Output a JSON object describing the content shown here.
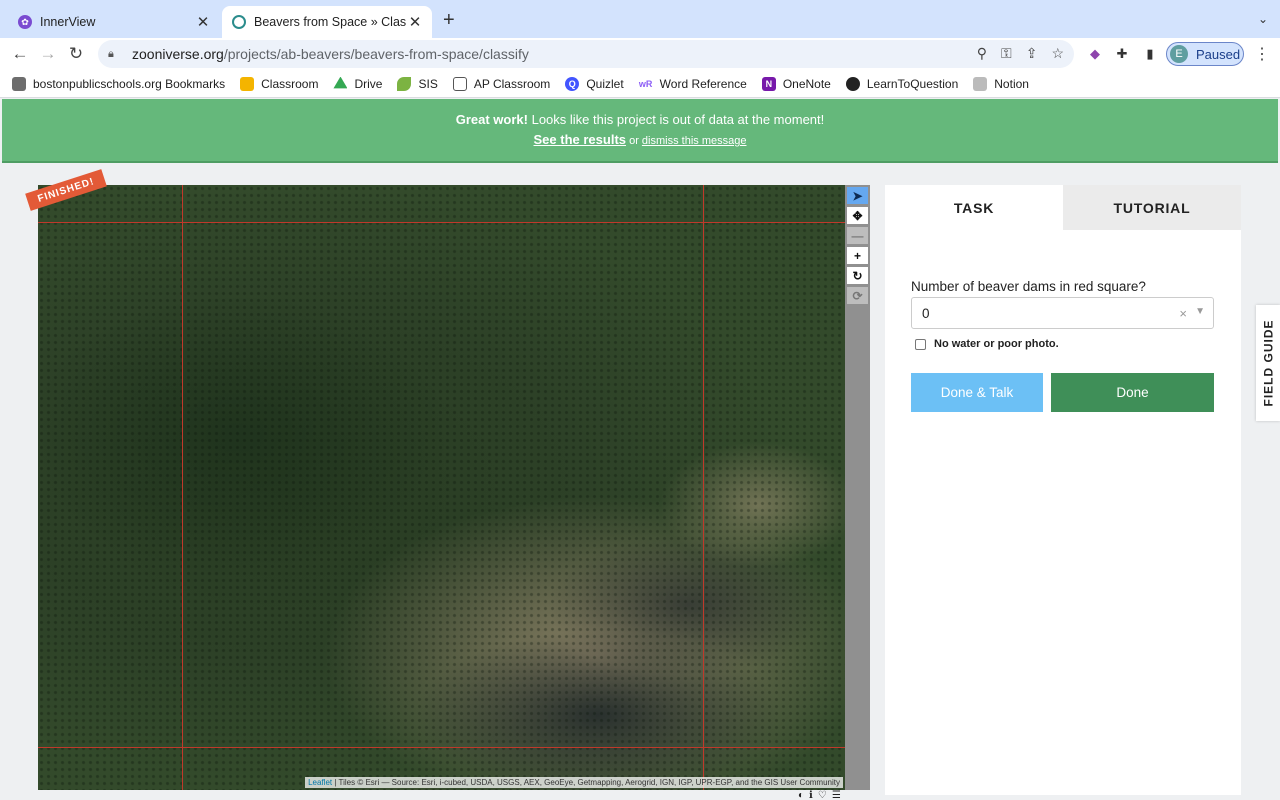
{
  "browser": {
    "tabs": [
      {
        "title": "InnerView",
        "active": false
      },
      {
        "title": "Beavers from Space » Classify",
        "active": true
      }
    ],
    "new_tab": "+",
    "tab_menu": "⌄",
    "url_host": "zooniverse.org",
    "url_path": "/projects/ab-beavers/beavers-from-space/classify",
    "profile_initial": "E",
    "profile_status": "Paused",
    "bookmarks": [
      {
        "label": "bostonpublicschools.org Bookmarks",
        "icon": "folder-icon",
        "color": "#6d6d6d"
      },
      {
        "label": "Classroom",
        "icon": "classroom-icon",
        "color": "#f4b400"
      },
      {
        "label": "Drive",
        "icon": "drive-icon",
        "color": "#34a853"
      },
      {
        "label": "SIS",
        "icon": "sis-icon",
        "color": "#7cb342"
      },
      {
        "label": "AP Classroom",
        "icon": "ap-icon",
        "color": "#555555"
      },
      {
        "label": "Quizlet",
        "icon": "quizlet-icon",
        "color": "#4255ff"
      },
      {
        "label": "Word Reference",
        "icon": "wordreference-icon",
        "color": "#8b5cf6"
      },
      {
        "label": "OneNote",
        "icon": "onenote-icon",
        "color": "#7719aa"
      },
      {
        "label": "LearnToQuestion",
        "icon": "globe-icon",
        "color": "#222222"
      },
      {
        "label": "Notion",
        "icon": "notion-icon",
        "color": "#999999"
      }
    ]
  },
  "banner": {
    "bold": "Great work!",
    "message": " Looks like this project is out of data at the moment!",
    "results_link": "See the results",
    "or": " or ",
    "dismiss_link": "dismiss this message",
    "color": "#65b87b"
  },
  "subject": {
    "finished_badge": "FINISHED!",
    "attribution_leaflet": "Leaflet",
    "attribution_rest": " | Tiles © Esri — Source: Esri, i-cubed, USDA, USGS, AEX, GeoEye, Getmapping, Aerogrid, IGN, IGP, UPR-EGP, and the GIS User Community"
  },
  "tools": [
    {
      "name": "pointer-tool",
      "glyph": "➤",
      "state": "selected"
    },
    {
      "name": "pan-tool",
      "glyph": "✥",
      "state": "normal"
    },
    {
      "name": "zoom-out-tool",
      "glyph": "—",
      "state": "disabled"
    },
    {
      "name": "zoom-in-tool",
      "glyph": "+",
      "state": "normal"
    },
    {
      "name": "rotate-tool",
      "glyph": "↻",
      "state": "normal"
    },
    {
      "name": "reset-tool",
      "glyph": "⟳",
      "state": "disabled"
    }
  ],
  "task_panel": {
    "tab_task": "TASK",
    "tab_tutorial": "TUTORIAL",
    "question": "Number of beaver dams in red square?",
    "select_value": "0",
    "select_clear": "×",
    "checkbox_label": "No water or poor photo.",
    "done_talk": "Done & Talk",
    "done": "Done"
  },
  "field_guide": "FIELD GUIDE"
}
